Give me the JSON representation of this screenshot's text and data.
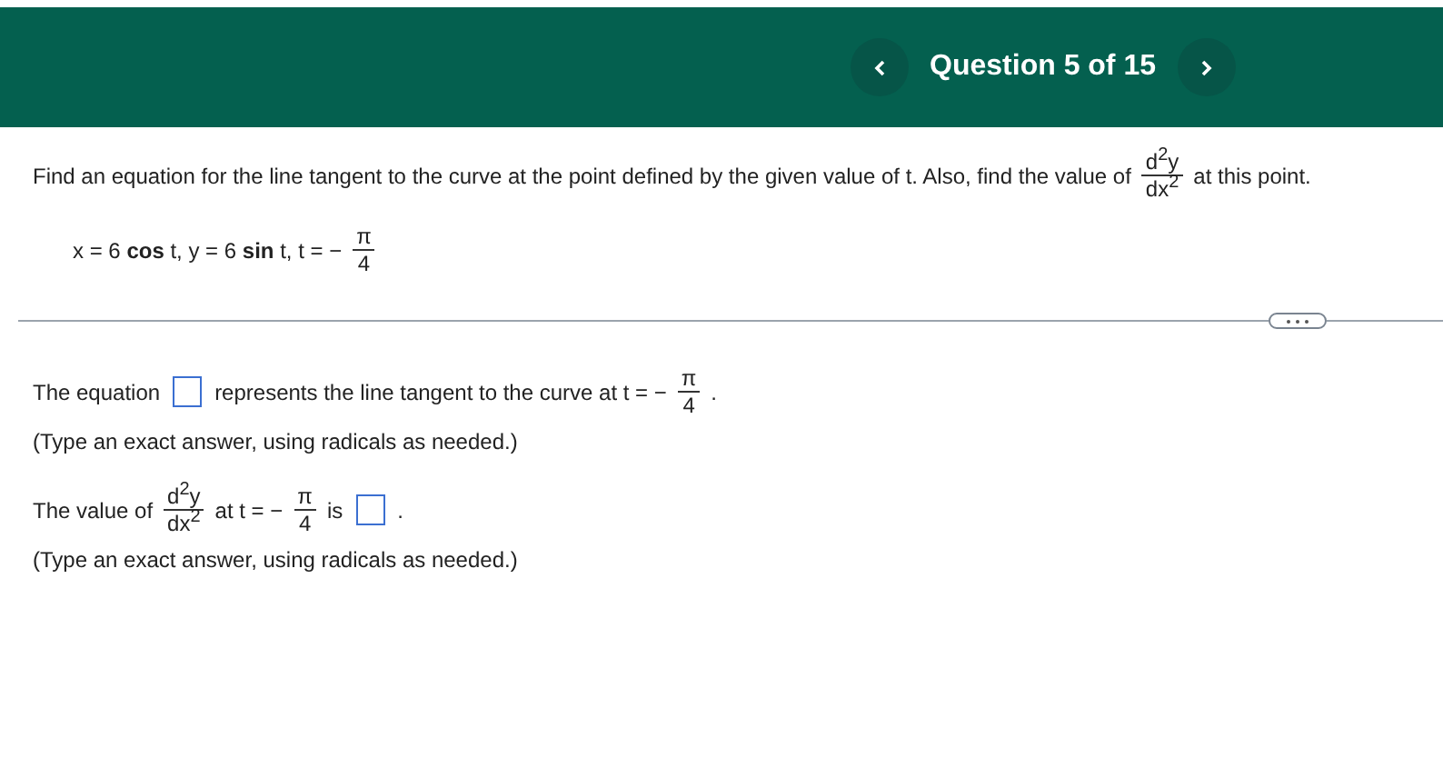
{
  "header": {
    "title": "Question 5 of 15"
  },
  "question": [
    {
      "kind": "text",
      "text": "Find an equation for the line tangent to the curve at the point defined by the given value of t. Also, find the value of"
    },
    {
      "kind": "fraction",
      "num": "d$^{2}$y",
      "den": "dx$^{2}$"
    },
    {
      "kind": "text",
      "text": "at this point."
    }
  ],
  "given": [
    {
      "kind": "text",
      "text": "x = 6 **cos** t, y = 6 **sin** t, t = −"
    },
    {
      "kind": "fraction",
      "num": "π",
      "den": "4"
    }
  ],
  "parts": [
    {
      "line": [
        {
          "kind": "text",
          "text": "The equation"
        },
        {
          "kind": "answer"
        },
        {
          "kind": "text",
          "text": "represents the line tangent to the curve at t = −"
        },
        {
          "kind": "fraction",
          "num": "π",
          "den": "4"
        },
        {
          "kind": "text",
          "text": "."
        }
      ],
      "hint": "(Type an exact answer, using radicals as needed.)"
    },
    {
      "line": [
        {
          "kind": "text",
          "text": "The value of"
        },
        {
          "kind": "fraction",
          "num": "d$^{2}$y",
          "den": "dx$^{2}$"
        },
        {
          "kind": "text",
          "text": "at t = −"
        },
        {
          "kind": "fraction",
          "num": "π",
          "den": "4"
        },
        {
          "kind": "text",
          "text": "is"
        },
        {
          "kind": "answer"
        },
        {
          "kind": "text",
          "text": "."
        }
      ],
      "hint": "(Type an exact answer, using radicals as needed.)"
    }
  ]
}
